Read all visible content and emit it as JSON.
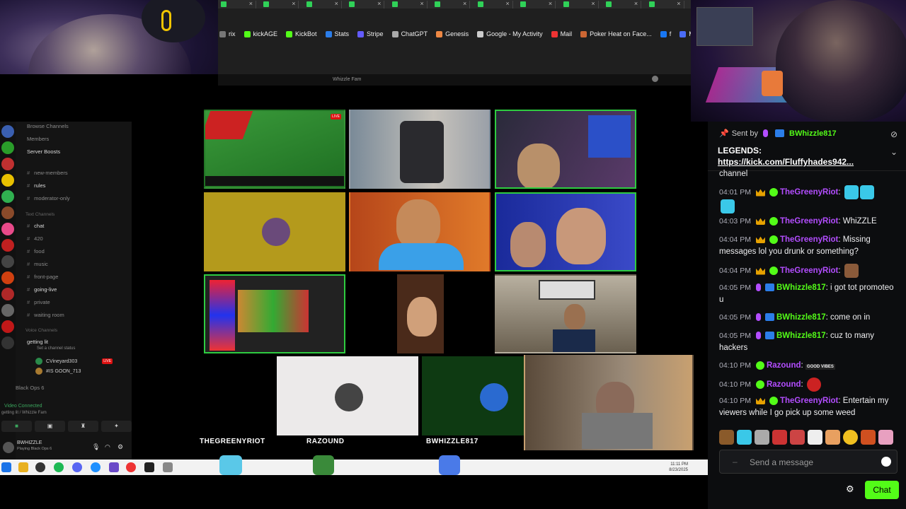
{
  "browser": {
    "bookmarks": [
      {
        "label": "rix",
        "icon": "folder-icon",
        "color": "#777"
      },
      {
        "label": "kickAGE",
        "icon": "kick-icon",
        "color": "#53fc18"
      },
      {
        "label": "KickBot",
        "icon": "kick-icon",
        "color": "#53fc18"
      },
      {
        "label": "Stats",
        "icon": "stats-icon",
        "color": "#2b7de9"
      },
      {
        "label": "Stripe",
        "icon": "stripe-icon",
        "color": "#635bff"
      },
      {
        "label": "ChatGPT",
        "icon": "chatgpt-icon",
        "color": "#aaa"
      },
      {
        "label": "Genesis",
        "icon": "genesis-icon",
        "color": "#e84"
      },
      {
        "label": "Google - My Activity",
        "icon": "google-icon",
        "color": "#ccc"
      },
      {
        "label": "Mail",
        "icon": "mail-icon",
        "color": "#e33"
      },
      {
        "label": "Poker Heat on Face...",
        "icon": "poker-icon",
        "color": "#c63"
      },
      {
        "label": "f",
        "icon": "facebook-icon",
        "color": "#1877f2"
      },
      {
        "label": "Messeng",
        "icon": "messenger-icon",
        "color": "#4a6cf7"
      }
    ]
  },
  "discord": {
    "window_title": "Whizzle Fam",
    "channels": {
      "top": [
        "Browse Channels",
        "Members",
        "Server Boosts"
      ],
      "info": [
        "new-members",
        "rules",
        "moderator-only"
      ],
      "text_category": "Text Channels",
      "text": [
        "chat",
        "420",
        "food",
        "music",
        "front-page",
        "going-live",
        "private",
        "waiting room"
      ],
      "voice_category": "Voice Channels",
      "voice_channel": "getting lit",
      "voice_sub": "Set a channel status",
      "voice_users": [
        "CVineyard303",
        "#IS GOON_713"
      ],
      "live_label": "LIVE",
      "game": "Black Ops 6"
    },
    "voice_status": "Video Connected",
    "voice_status_sub": "getting lit / Whizzle Fam",
    "me": {
      "name": "BWHIZZLE",
      "status": "Playing Black Ops 6"
    },
    "tile_names": [
      "THEGREENYRIOT",
      "RAZOUND",
      "BWHIZZLE817"
    ],
    "live_tag": "LIVE"
  },
  "taskbar": {
    "time": "11:11 PM",
    "date": "8/23/2025"
  },
  "chat": {
    "pinned": {
      "sent_by_label": "Sent by",
      "sent_by_user": "BWhizzle817",
      "title": "LEGENDS:",
      "link": "https://kick.com/Fluffyhades942..."
    },
    "partial_top": "channel",
    "messages": [
      {
        "time": "04:01 PM",
        "user": "TheGreenyRiot",
        "text": "",
        "color": "#b34dff"
      },
      {
        "time": "04:03 PM",
        "user": "TheGreenyRiot",
        "text": "WhiZZLE",
        "color": "#b34dff"
      },
      {
        "time": "04:04 PM",
        "user": "TheGreenyRiot",
        "text": "Missing messages lol you drunk or something?",
        "color": "#b34dff"
      },
      {
        "time": "04:04 PM",
        "user": "TheGreenyRiot",
        "text": "",
        "color": "#b34dff"
      },
      {
        "time": "04:05 PM",
        "user": "BWhizzle817",
        "text": "i got tot promoteo u",
        "color": "#53fc18"
      },
      {
        "time": "04:05 PM",
        "user": "BWhizzle817",
        "text": "come on in",
        "color": "#53fc18"
      },
      {
        "time": "04:05 PM",
        "user": "BWhizzle817",
        "text": "cuz to many hackers",
        "color": "#53fc18"
      },
      {
        "time": "04:10 PM",
        "user": "Razound",
        "text": "",
        "color": "#b34dff"
      },
      {
        "time": "04:10 PM",
        "user": "Razound",
        "text": "",
        "color": "#b34dff"
      },
      {
        "time": "04:10 PM",
        "user": "TheGreenyRiot",
        "text": "Entertain my viewers while I go pick up some weed",
        "color": "#b34dff"
      }
    ],
    "emote_badge": "GOOD VIBES",
    "input_placeholder": "Send a message",
    "chat_button": "Chat",
    "accent": "#53fc18"
  }
}
